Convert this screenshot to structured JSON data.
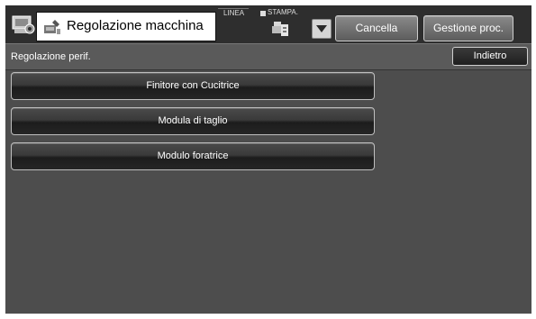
{
  "header": {
    "title": "Regolazione macchina",
    "linea_label": "LINEA",
    "stampa_label": "STAMPA.",
    "cancel_label": "Cancella",
    "process_label": "Gestione proc."
  },
  "subheader": {
    "title": "Regolazione perif.",
    "back_label": "Indietro"
  },
  "menu": {
    "items": [
      {
        "label": "Finitore con Cucitrice"
      },
      {
        "label": "Modula di taglio"
      },
      {
        "label": "Modulo foratrice"
      }
    ]
  },
  "icons": {
    "home": "machine-settings-icon",
    "title": "machine-adjust-icon",
    "printer": "printer-icon",
    "dropdown": "triangle-down-icon"
  }
}
